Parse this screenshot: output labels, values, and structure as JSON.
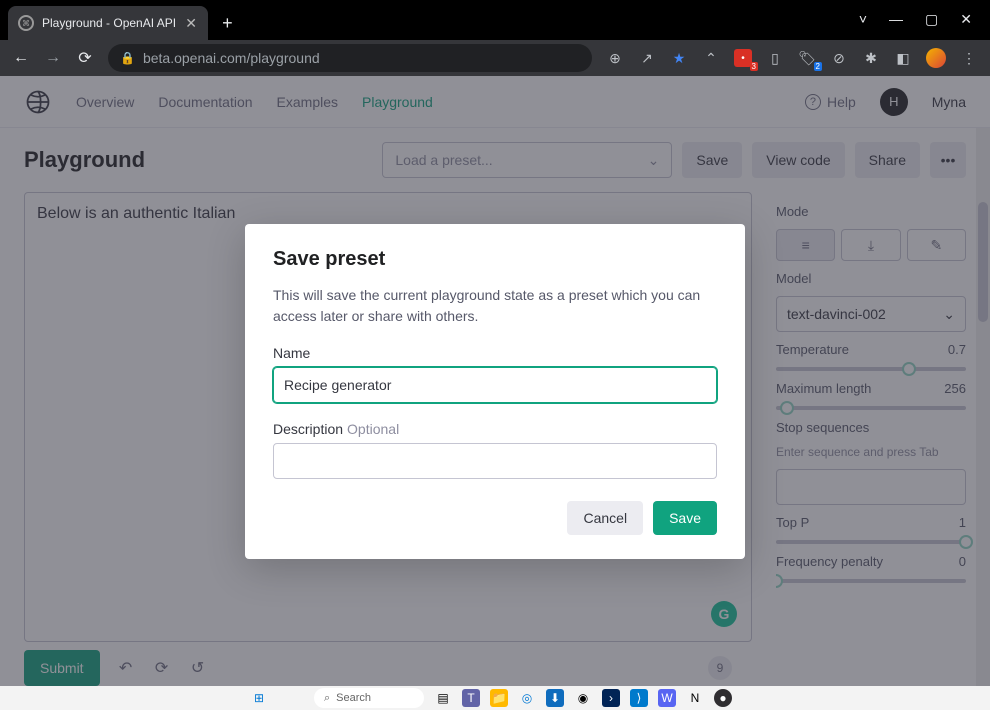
{
  "browser": {
    "tab_title": "Playground - OpenAI API",
    "url": "beta.openai.com/playground"
  },
  "win_controls": {
    "down": "˅",
    "min": "—",
    "max": "▢",
    "close": "✕"
  },
  "header": {
    "nav": {
      "overview": "Overview",
      "documentation": "Documentation",
      "examples": "Examples",
      "playground": "Playground"
    },
    "help": "Help",
    "user_initial": "H",
    "user_name": "Myna"
  },
  "page": {
    "title": "Playground",
    "preset_placeholder": "Load a preset...",
    "save": "Save",
    "view_code": "View code",
    "share": "Share"
  },
  "editor": {
    "prompt_text": "Below is an authentic Italian",
    "submit": "Submit",
    "grammarly": "G",
    "token_count": "9"
  },
  "sidebar": {
    "mode_label": "Mode",
    "model_label": "Model",
    "model_value": "text-davinci-002",
    "temperature_label": "Temperature",
    "temperature_value": "0.7",
    "maxlen_label": "Maximum length",
    "maxlen_value": "256",
    "stop_label": "Stop sequences",
    "stop_hint": "Enter sequence and press Tab",
    "topp_label": "Top P",
    "topp_value": "1",
    "freq_label": "Frequency penalty",
    "freq_value": "0"
  },
  "modal": {
    "title": "Save preset",
    "description": "This will save the current playground state as a preset which you can access later or share with others.",
    "name_label": "Name",
    "name_value": "Recipe generator",
    "desc_label": "Description",
    "desc_optional": "Optional",
    "cancel": "Cancel",
    "save": "Save"
  },
  "taskbar": {
    "search": "Search"
  }
}
